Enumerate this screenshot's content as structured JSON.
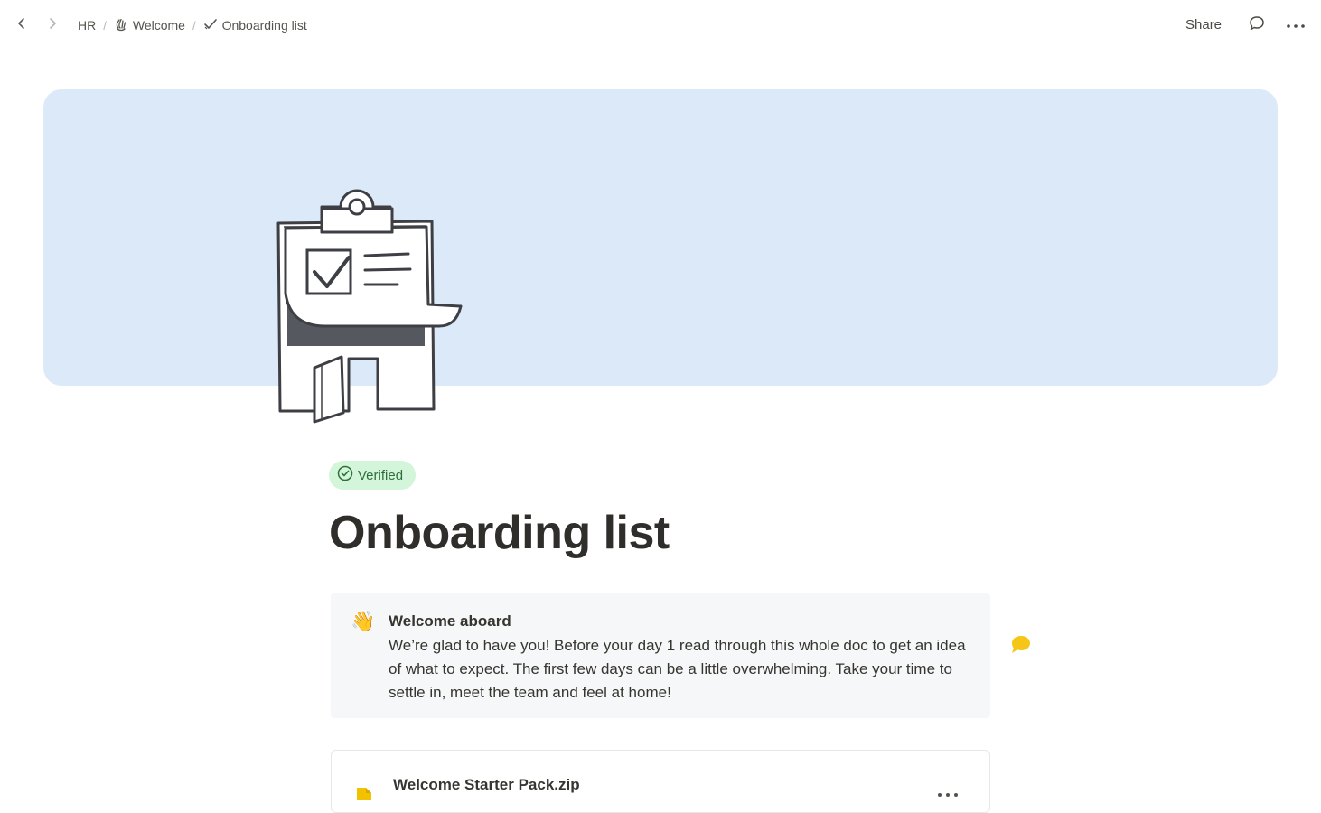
{
  "breadcrumb": {
    "items": [
      {
        "label": "HR",
        "icon": ""
      },
      {
        "label": "Welcome",
        "icon": "waving-hand-icon"
      },
      {
        "label": "Onboarding list",
        "icon": "checkmark-icon"
      }
    ],
    "separator": "/"
  },
  "topbar": {
    "share_label": "Share"
  },
  "page": {
    "badge": "Verified",
    "title": "Onboarding list"
  },
  "callout": {
    "emoji": "👋",
    "title": "Welcome aboard",
    "body": "We’re glad to have you! Before your day 1 read through this whole doc to get an idea of what to expect. The first few days can be a little overwhelming. Take your time to settle in, meet the team and feel at home!"
  },
  "attachment": {
    "name": "Welcome Starter Pack.zip"
  },
  "colors": {
    "banner": "#dce9f8",
    "badge_bg": "#d3f5d9",
    "badge_text": "#2f6f3d",
    "comment_bubble": "#f5c518",
    "file_icon": "#f2c200"
  }
}
